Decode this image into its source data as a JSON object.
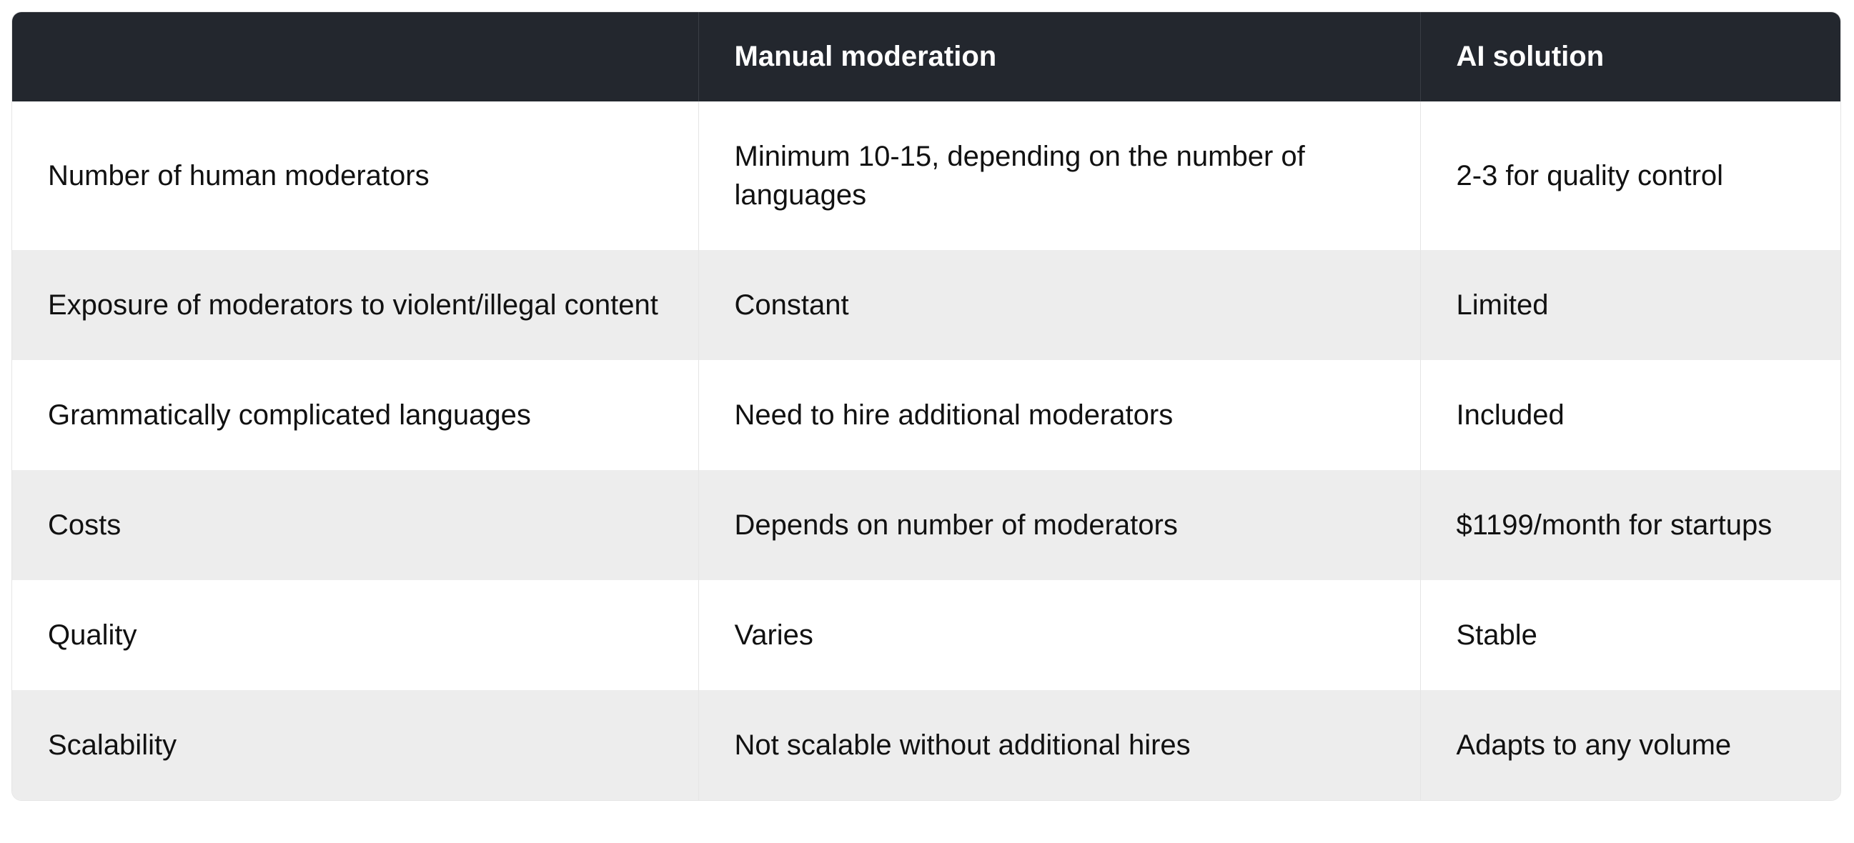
{
  "comparison_table": {
    "headers": [
      "",
      "Manual moderation",
      "AI solution"
    ],
    "rows": [
      {
        "label": "Number of human moderators",
        "manual": "Minimum 10-15, depending on the number of languages",
        "ai": "2-3 for quality control"
      },
      {
        "label": "Exposure of moderators to violent/illegal content",
        "manual": "Constant",
        "ai": "Limited"
      },
      {
        "label": "Grammatically complicated languages",
        "manual": "Need to hire additional moderators",
        "ai": "Included"
      },
      {
        "label": "Costs",
        "manual": "Depends on number of moderators",
        "ai": "$1199/month for startups"
      },
      {
        "label": "Quality",
        "manual": "Varies",
        "ai": "Stable"
      },
      {
        "label": "Scalability",
        "manual": "Not scalable without additional hires",
        "ai": "Adapts to any volume"
      }
    ]
  }
}
